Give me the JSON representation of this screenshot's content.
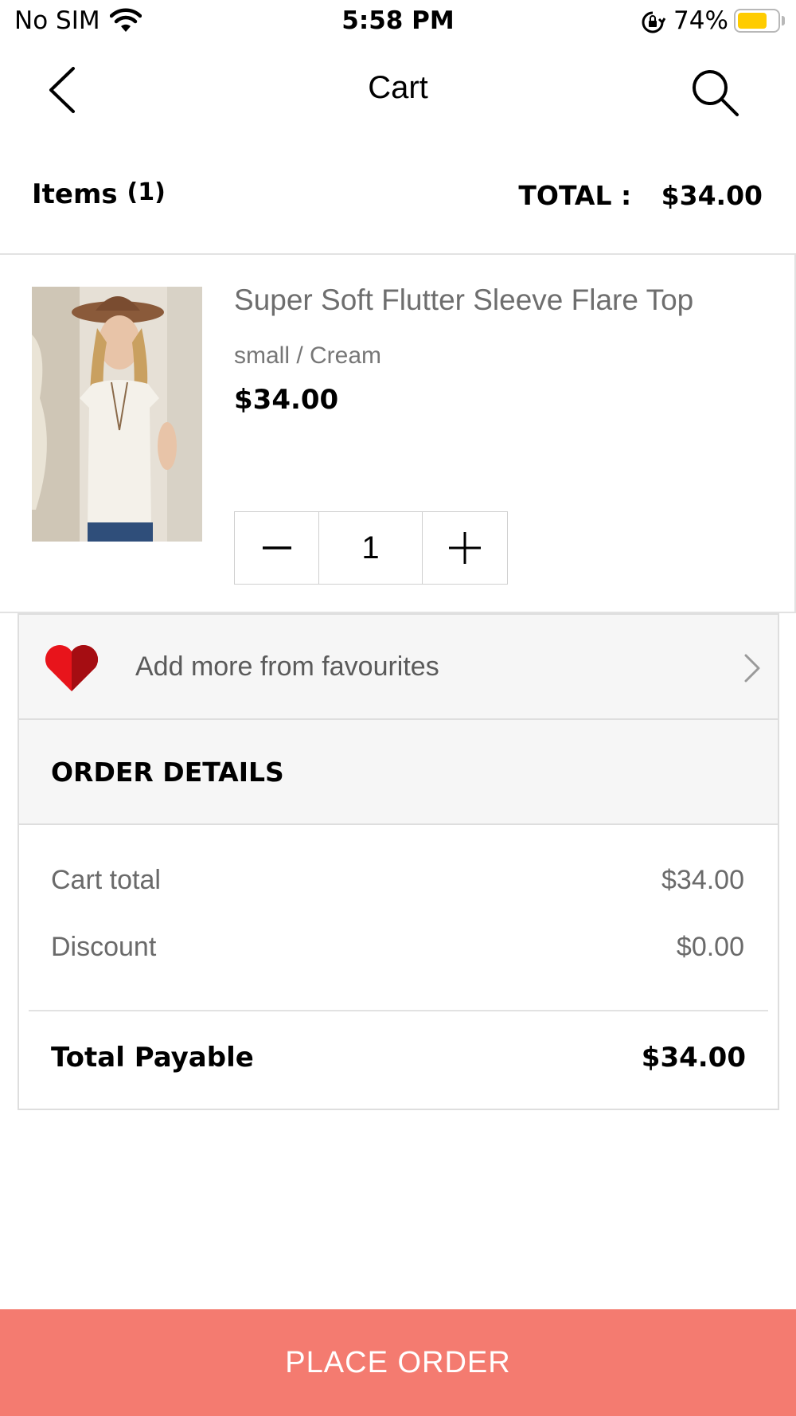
{
  "status_bar": {
    "carrier": "No SIM",
    "time": "5:58 PM",
    "battery_percent": "74%",
    "battery_level": 0.74,
    "icons": [
      "wifi-icon",
      "orientation-lock-icon",
      "battery-icon"
    ]
  },
  "nav": {
    "title": "Cart",
    "back_icon": "chevron-left-icon",
    "search_icon": "search-icon"
  },
  "summary": {
    "items_label": "Items",
    "items_count": "(1)",
    "total_label": "TOTAL :",
    "total_value": "$34.00"
  },
  "cart_items": [
    {
      "name": "Super Soft Flutter Sleeve Flare Top",
      "variant": "small / Cream",
      "price": "$34.00",
      "quantity": "1",
      "image_icon": "product-photo"
    }
  ],
  "favourites": {
    "label": "Add more from favourites",
    "icon": "heart-icon",
    "heart_color": "#e8141b"
  },
  "order_details": {
    "title": "ORDER DETAILS",
    "cart_total_label": "Cart total",
    "cart_total_value": "$34.00",
    "discount_label": "Discount",
    "discount_value": "$0.00",
    "total_payable_label": "Total Payable",
    "total_payable_value": "$34.00"
  },
  "place_order": {
    "label": "PLACE ORDER",
    "color": "#f47b70"
  }
}
